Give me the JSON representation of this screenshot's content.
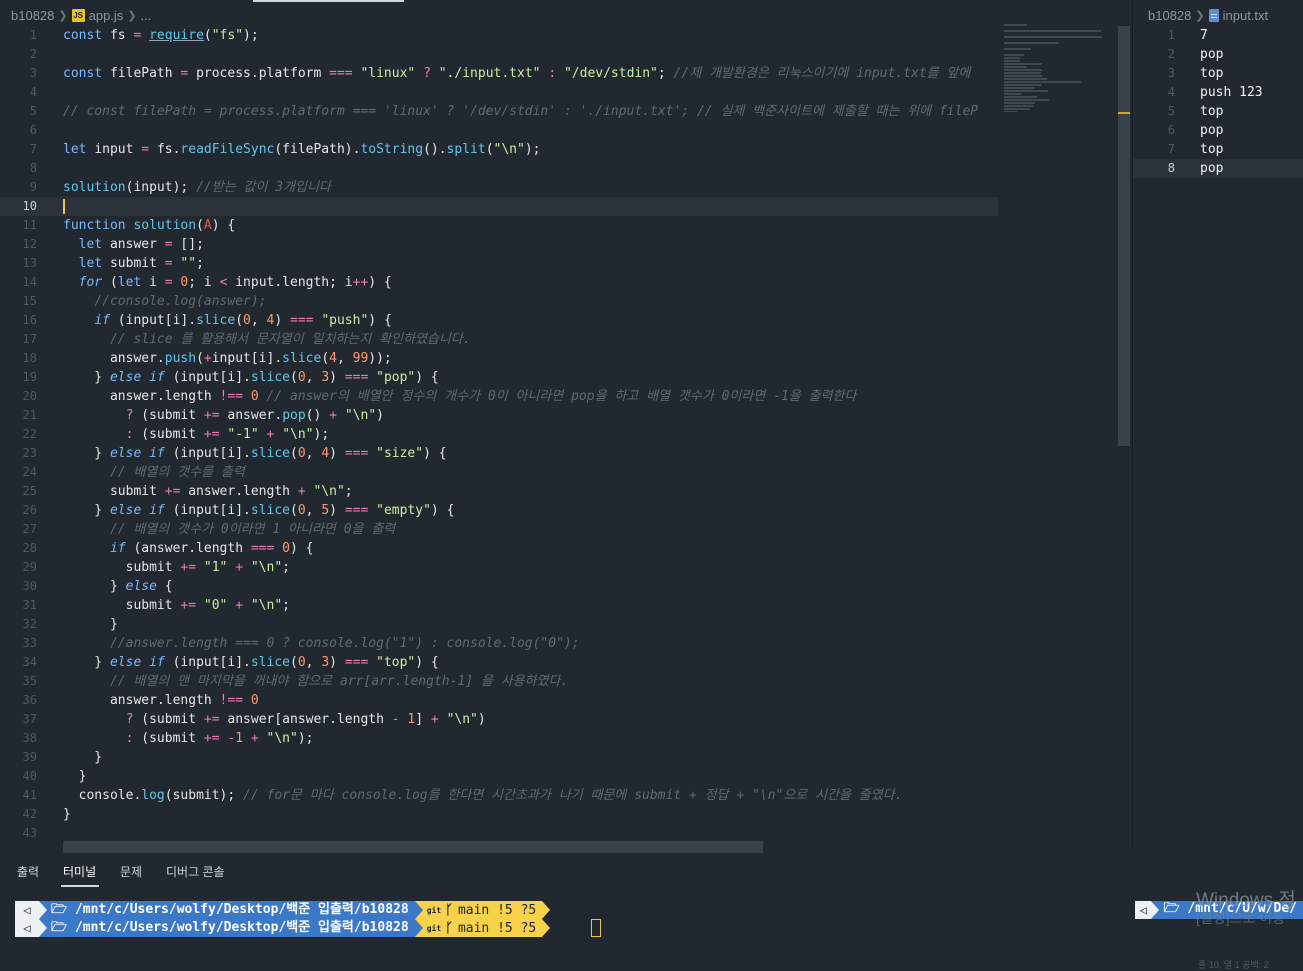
{
  "left_breadcrumb": {
    "folder": "b10828",
    "file": "app.js",
    "more": "..."
  },
  "right_breadcrumb": {
    "folder": "b10828",
    "file": "input.txt"
  },
  "editor": {
    "current_line": 10,
    "lines": [
      {
        "n": "1",
        "tokens": [
          [
            "t-kw",
            "const "
          ],
          [
            "t-var",
            "fs "
          ],
          [
            "t-op",
            "= "
          ],
          [
            "t-req",
            "require"
          ],
          [
            "t-var",
            "("
          ],
          [
            "t-str",
            "\"fs\""
          ],
          [
            "t-var",
            ");"
          ]
        ]
      },
      {
        "n": "2",
        "tokens": []
      },
      {
        "n": "3",
        "tokens": [
          [
            "t-kw",
            "const "
          ],
          [
            "t-var",
            "filePath "
          ],
          [
            "t-op",
            "= "
          ],
          [
            "t-var",
            "process.platform "
          ],
          [
            "t-op",
            "=== "
          ],
          [
            "t-str",
            "\"linux\" "
          ],
          [
            "t-op",
            "? "
          ],
          [
            "t-str",
            "\"./input.txt\" "
          ],
          [
            "t-op",
            ": "
          ],
          [
            "t-str",
            "\"/dev/stdin\""
          ],
          [
            "t-var",
            "; "
          ],
          [
            "t-cm",
            "//제 개발환경은 리눅스이기에 input.txt를 앞에"
          ]
        ]
      },
      {
        "n": "4",
        "tokens": []
      },
      {
        "n": "5",
        "tokens": [
          [
            "t-cm",
            "// const filePath = process.platform === 'linux' ? '/dev/stdin' : './input.txt'; // 실제 백준사이트에 제출할 때는 위에 fileP"
          ]
        ]
      },
      {
        "n": "6",
        "tokens": []
      },
      {
        "n": "7",
        "tokens": [
          [
            "t-kw",
            "let "
          ],
          [
            "t-var",
            "input "
          ],
          [
            "t-op",
            "= "
          ],
          [
            "t-var",
            "fs."
          ],
          [
            "t-fn",
            "readFileSync"
          ],
          [
            "t-var",
            "(filePath)."
          ],
          [
            "t-fn",
            "toString"
          ],
          [
            "t-var",
            "()."
          ],
          [
            "t-fn",
            "split"
          ],
          [
            "t-var",
            "("
          ],
          [
            "t-str",
            "\"\\n\""
          ],
          [
            "t-var",
            ");"
          ]
        ]
      },
      {
        "n": "8",
        "tokens": []
      },
      {
        "n": "9",
        "tokens": [
          [
            "t-fn",
            "solution"
          ],
          [
            "t-var",
            "(input); "
          ],
          [
            "t-cm",
            "//받는 값이 3개입니다"
          ]
        ]
      },
      {
        "n": "10",
        "tokens": []
      },
      {
        "n": "11",
        "tokens": [
          [
            "t-kw",
            "function "
          ],
          [
            "t-fn",
            "solution"
          ],
          [
            "t-var",
            "("
          ],
          [
            "t-param",
            "A"
          ],
          [
            "t-var",
            ") {"
          ]
        ]
      },
      {
        "n": "12",
        "tokens": [
          [
            "t-var",
            "  "
          ],
          [
            "t-kw",
            "let "
          ],
          [
            "t-var",
            "answer "
          ],
          [
            "t-op",
            "= "
          ],
          [
            "t-var",
            "[];"
          ]
        ]
      },
      {
        "n": "13",
        "tokens": [
          [
            "t-var",
            "  "
          ],
          [
            "t-kw",
            "let "
          ],
          [
            "t-var",
            "submit "
          ],
          [
            "t-op",
            "= "
          ],
          [
            "t-str",
            "\"\""
          ],
          [
            "t-var",
            ";"
          ]
        ]
      },
      {
        "n": "14",
        "tokens": [
          [
            "t-var",
            "  "
          ],
          [
            "t-it",
            "for "
          ],
          [
            "t-var",
            "("
          ],
          [
            "t-kw",
            "let "
          ],
          [
            "t-var",
            "i "
          ],
          [
            "t-op",
            "= "
          ],
          [
            "t-num",
            "0"
          ],
          [
            "t-var",
            "; i "
          ],
          [
            "t-op",
            "< "
          ],
          [
            "t-var",
            "input.length; i"
          ],
          [
            "t-op",
            "++"
          ],
          [
            "t-var",
            ") {"
          ]
        ]
      },
      {
        "n": "15",
        "tokens": [
          [
            "t-var",
            "    "
          ],
          [
            "t-cm",
            "//console.log(answer);"
          ]
        ]
      },
      {
        "n": "16",
        "tokens": [
          [
            "t-var",
            "    "
          ],
          [
            "t-it",
            "if "
          ],
          [
            "t-var",
            "(input[i]."
          ],
          [
            "t-fn",
            "slice"
          ],
          [
            "t-var",
            "("
          ],
          [
            "t-num",
            "0"
          ],
          [
            "t-var",
            ", "
          ],
          [
            "t-num",
            "4"
          ],
          [
            "t-var",
            ") "
          ],
          [
            "t-op",
            "=== "
          ],
          [
            "t-str",
            "\"push\""
          ],
          [
            "t-var",
            ") {"
          ]
        ]
      },
      {
        "n": "17",
        "tokens": [
          [
            "t-var",
            "      "
          ],
          [
            "t-cm",
            "// slice 를 활용해서 문자열이 일치하는지 확인하였습니다."
          ]
        ]
      },
      {
        "n": "18",
        "tokens": [
          [
            "t-var",
            "      answer."
          ],
          [
            "t-fn",
            "push"
          ],
          [
            "t-var",
            "("
          ],
          [
            "t-op",
            "+"
          ],
          [
            "t-var",
            "input[i]."
          ],
          [
            "t-fn",
            "slice"
          ],
          [
            "t-var",
            "("
          ],
          [
            "t-num",
            "4"
          ],
          [
            "t-var",
            ", "
          ],
          [
            "t-num",
            "99"
          ],
          [
            "t-var",
            "));"
          ]
        ]
      },
      {
        "n": "19",
        "tokens": [
          [
            "t-var",
            "    } "
          ],
          [
            "t-it",
            "else if "
          ],
          [
            "t-var",
            "(input[i]."
          ],
          [
            "t-fn",
            "slice"
          ],
          [
            "t-var",
            "("
          ],
          [
            "t-num",
            "0"
          ],
          [
            "t-var",
            ", "
          ],
          [
            "t-num",
            "3"
          ],
          [
            "t-var",
            ") "
          ],
          [
            "t-op",
            "=== "
          ],
          [
            "t-str",
            "\"pop\""
          ],
          [
            "t-var",
            ") {"
          ]
        ]
      },
      {
        "n": "20",
        "tokens": [
          [
            "t-var",
            "      answer.length "
          ],
          [
            "t-op",
            "!== "
          ],
          [
            "t-num",
            "0 "
          ],
          [
            "t-cm",
            "// answer의 배열안 정수의 개수가 0이 아니라면 pop을 하고 배열 갯수가 0이라면 -1을 출력한다"
          ]
        ]
      },
      {
        "n": "21",
        "tokens": [
          [
            "t-var",
            "        "
          ],
          [
            "t-op",
            "? "
          ],
          [
            "t-var",
            "(submit "
          ],
          [
            "t-op",
            "+= "
          ],
          [
            "t-var",
            "answer."
          ],
          [
            "t-fn",
            "pop"
          ],
          [
            "t-var",
            "() "
          ],
          [
            "t-op",
            "+ "
          ],
          [
            "t-str",
            "\"\\n\""
          ],
          [
            "t-var",
            ")"
          ]
        ]
      },
      {
        "n": "22",
        "tokens": [
          [
            "t-var",
            "        "
          ],
          [
            "t-op",
            ": "
          ],
          [
            "t-var",
            "(submit "
          ],
          [
            "t-op",
            "+= "
          ],
          [
            "t-str",
            "\"-1\" "
          ],
          [
            "t-op",
            "+ "
          ],
          [
            "t-str",
            "\"\\n\""
          ],
          [
            "t-var",
            ");"
          ]
        ]
      },
      {
        "n": "23",
        "tokens": [
          [
            "t-var",
            "    } "
          ],
          [
            "t-it",
            "else if "
          ],
          [
            "t-var",
            "(input[i]."
          ],
          [
            "t-fn",
            "slice"
          ],
          [
            "t-var",
            "("
          ],
          [
            "t-num",
            "0"
          ],
          [
            "t-var",
            ", "
          ],
          [
            "t-num",
            "4"
          ],
          [
            "t-var",
            ") "
          ],
          [
            "t-op",
            "=== "
          ],
          [
            "t-str",
            "\"size\""
          ],
          [
            "t-var",
            ") {"
          ]
        ]
      },
      {
        "n": "24",
        "tokens": [
          [
            "t-var",
            "      "
          ],
          [
            "t-cm",
            "// 배열의 갯수를 출력"
          ]
        ]
      },
      {
        "n": "25",
        "tokens": [
          [
            "t-var",
            "      submit "
          ],
          [
            "t-op",
            "+= "
          ],
          [
            "t-var",
            "answer.length "
          ],
          [
            "t-op",
            "+ "
          ],
          [
            "t-str",
            "\"\\n\""
          ],
          [
            "t-var",
            ";"
          ]
        ]
      },
      {
        "n": "26",
        "tokens": [
          [
            "t-var",
            "    } "
          ],
          [
            "t-it",
            "else if "
          ],
          [
            "t-var",
            "(input[i]."
          ],
          [
            "t-fn",
            "slice"
          ],
          [
            "t-var",
            "("
          ],
          [
            "t-num",
            "0"
          ],
          [
            "t-var",
            ", "
          ],
          [
            "t-num",
            "5"
          ],
          [
            "t-var",
            ") "
          ],
          [
            "t-op",
            "=== "
          ],
          [
            "t-str",
            "\"empty\""
          ],
          [
            "t-var",
            ") {"
          ]
        ]
      },
      {
        "n": "27",
        "tokens": [
          [
            "t-var",
            "      "
          ],
          [
            "t-cm",
            "// 배열의 갯수가 0이라면 1 아니라면 0을 출력"
          ]
        ]
      },
      {
        "n": "28",
        "tokens": [
          [
            "t-var",
            "      "
          ],
          [
            "t-it",
            "if "
          ],
          [
            "t-var",
            "(answer.length "
          ],
          [
            "t-op",
            "=== "
          ],
          [
            "t-num",
            "0"
          ],
          [
            "t-var",
            ") {"
          ]
        ]
      },
      {
        "n": "29",
        "tokens": [
          [
            "t-var",
            "        submit "
          ],
          [
            "t-op",
            "+= "
          ],
          [
            "t-str",
            "\"1\" "
          ],
          [
            "t-op",
            "+ "
          ],
          [
            "t-str",
            "\"\\n\""
          ],
          [
            "t-var",
            ";"
          ]
        ]
      },
      {
        "n": "30",
        "tokens": [
          [
            "t-var",
            "      } "
          ],
          [
            "t-it",
            "else "
          ],
          [
            "t-var",
            "{"
          ]
        ]
      },
      {
        "n": "31",
        "tokens": [
          [
            "t-var",
            "        submit "
          ],
          [
            "t-op",
            "+= "
          ],
          [
            "t-str",
            "\"0\" "
          ],
          [
            "t-op",
            "+ "
          ],
          [
            "t-str",
            "\"\\n\""
          ],
          [
            "t-var",
            ";"
          ]
        ]
      },
      {
        "n": "32",
        "tokens": [
          [
            "t-var",
            "      }"
          ]
        ]
      },
      {
        "n": "33",
        "tokens": [
          [
            "t-var",
            "      "
          ],
          [
            "t-cm",
            "//answer.length === 0 ? console.log(\"1\") : console.log(\"0\");"
          ]
        ]
      },
      {
        "n": "34",
        "tokens": [
          [
            "t-var",
            "    } "
          ],
          [
            "t-it",
            "else if "
          ],
          [
            "t-var",
            "(input[i]."
          ],
          [
            "t-fn",
            "slice"
          ],
          [
            "t-var",
            "("
          ],
          [
            "t-num",
            "0"
          ],
          [
            "t-var",
            ", "
          ],
          [
            "t-num",
            "3"
          ],
          [
            "t-var",
            ") "
          ],
          [
            "t-op",
            "=== "
          ],
          [
            "t-str",
            "\"top\""
          ],
          [
            "t-var",
            ") {"
          ]
        ]
      },
      {
        "n": "35",
        "tokens": [
          [
            "t-var",
            "      "
          ],
          [
            "t-cm",
            "// 배열의 맨 마지막을 꺼내야 함으로 arr[arr.length-1] 을 사용하였다."
          ]
        ]
      },
      {
        "n": "36",
        "tokens": [
          [
            "t-var",
            "      answer.length "
          ],
          [
            "t-op",
            "!== "
          ],
          [
            "t-num",
            "0"
          ]
        ]
      },
      {
        "n": "37",
        "tokens": [
          [
            "t-var",
            "        "
          ],
          [
            "t-op",
            "? "
          ],
          [
            "t-var",
            "(submit "
          ],
          [
            "t-op",
            "+= "
          ],
          [
            "t-var",
            "answer[answer.length "
          ],
          [
            "t-op",
            "- "
          ],
          [
            "t-num",
            "1"
          ],
          [
            "t-var",
            "] "
          ],
          [
            "t-op",
            "+ "
          ],
          [
            "t-str",
            "\"\\n\""
          ],
          [
            "t-var",
            ")"
          ]
        ]
      },
      {
        "n": "38",
        "tokens": [
          [
            "t-var",
            "        "
          ],
          [
            "t-op",
            ": "
          ],
          [
            "t-var",
            "(submit "
          ],
          [
            "t-op",
            "+= -"
          ],
          [
            "t-num",
            "1 "
          ],
          [
            "t-op",
            "+ "
          ],
          [
            "t-str",
            "\"\\n\""
          ],
          [
            "t-var",
            ");"
          ]
        ]
      },
      {
        "n": "39",
        "tokens": [
          [
            "t-var",
            "    }"
          ]
        ]
      },
      {
        "n": "40",
        "tokens": [
          [
            "t-var",
            "  }"
          ]
        ]
      },
      {
        "n": "41",
        "tokens": [
          [
            "t-var",
            "  console."
          ],
          [
            "t-fn",
            "log"
          ],
          [
            "t-var",
            "(submit); "
          ],
          [
            "t-cm",
            "// for문 마다 console.log를 한다면 시간초과가 나기 때문에 submit + 정답 + \"\\n\"으로 시간을 줄였다."
          ]
        ]
      },
      {
        "n": "42",
        "tokens": [
          [
            "t-var",
            "}"
          ]
        ]
      },
      {
        "n": "43",
        "tokens": []
      }
    ]
  },
  "input_txt": {
    "current_line": 8,
    "lines": [
      {
        "n": "1",
        "text": "7"
      },
      {
        "n": "2",
        "text": "pop"
      },
      {
        "n": "3",
        "text": "top"
      },
      {
        "n": "4",
        "text": "push 123"
      },
      {
        "n": "5",
        "text": "top"
      },
      {
        "n": "6",
        "text": "pop"
      },
      {
        "n": "7",
        "text": "top"
      },
      {
        "n": "8",
        "text": "pop"
      }
    ]
  },
  "panel": {
    "tabs": [
      "출력",
      "터미널",
      "문제",
      "디버그 콘솔"
    ],
    "active_tab": "터미널"
  },
  "terminal": {
    "prompts": [
      {
        "icon": "◁",
        "path": "🗁 /mnt/c/Users/wolfy/Desktop/백준 입출력/b10828",
        "git": "git",
        "branch": "main !5 ?5"
      },
      {
        "icon": "◁",
        "path": "🗁 /mnt/c/Users/wolfy/Desktop/백준 입출력/b10828",
        "git": "git",
        "branch": "main !5 ?5"
      }
    ],
    "right_prompt": {
      "icon": "◁",
      "path": "🗁 /mnt/c/U/w/De/"
    }
  },
  "windows_watermark": {
    "line1": "Windows 정",
    "line2": "[설정]으로 이동",
    "line3": "줄 10, 열 1    공백: 2"
  }
}
